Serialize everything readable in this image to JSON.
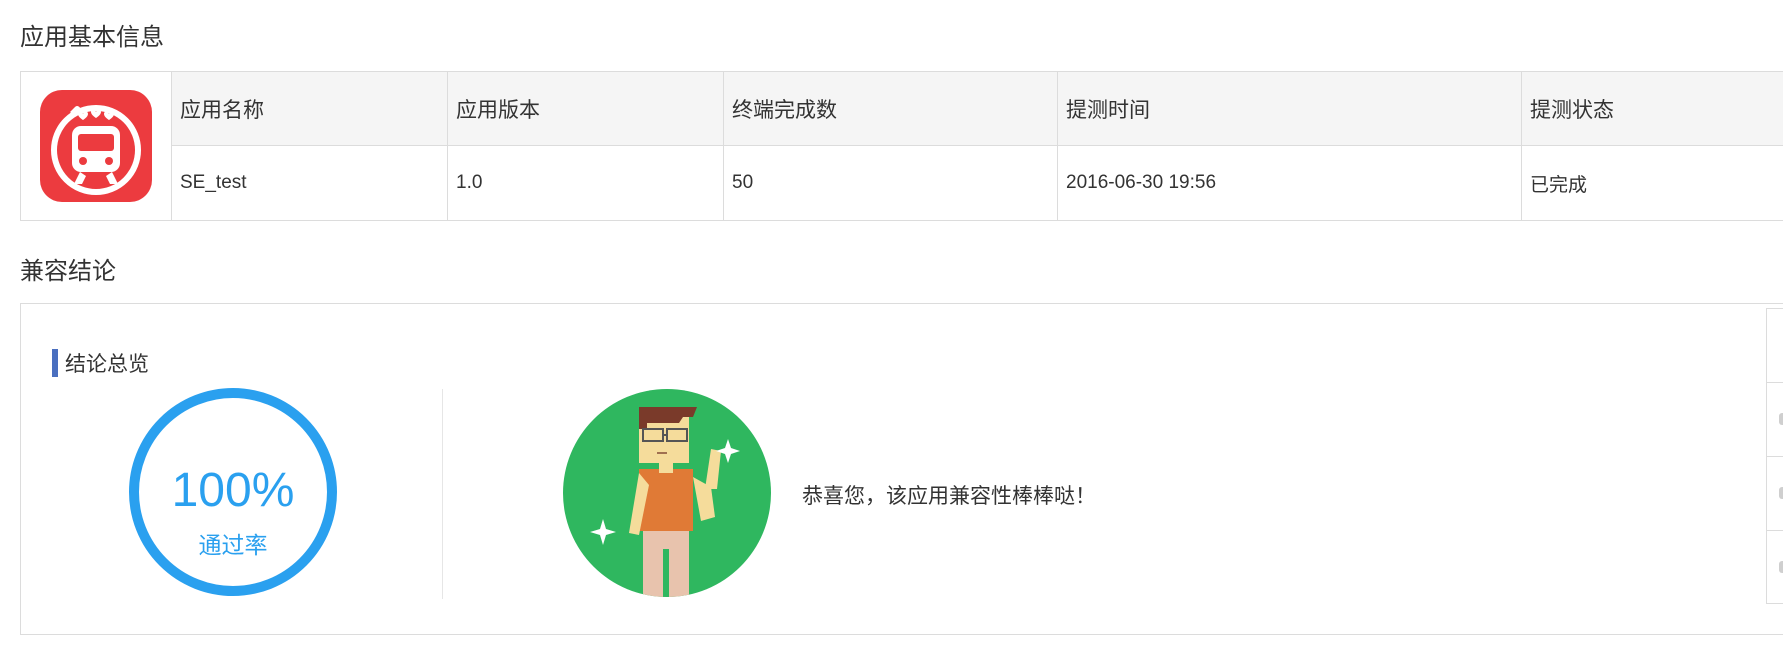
{
  "sections": {
    "basic_info_title": "应用基本信息",
    "compat_title": "兼容结论"
  },
  "app_icon": "subway-train-icon",
  "table": {
    "columns": [
      {
        "header": "应用名称",
        "value": "SE_test"
      },
      {
        "header": "应用版本",
        "value": "1.0"
      },
      {
        "header": "终端完成数",
        "value": "50"
      },
      {
        "header": "提测时间",
        "value": "2016-06-30 19:56"
      },
      {
        "header": "提测状态",
        "value": "已完成"
      }
    ]
  },
  "conclusion": {
    "subtitle": "结论总览",
    "pass_rate": "100%",
    "pass_rate_value": 1.0,
    "pass_rate_label": "通过率",
    "message": "恭喜您，该应用兼容性棒棒哒！",
    "illustration": "thumbs-up-man-icon"
  },
  "colors": {
    "ring": "#2aa0ef",
    "accent_bar": "#4a6fbf",
    "icon_bg": "#ec3b3f",
    "avatar_bg": "#2fb75f"
  }
}
